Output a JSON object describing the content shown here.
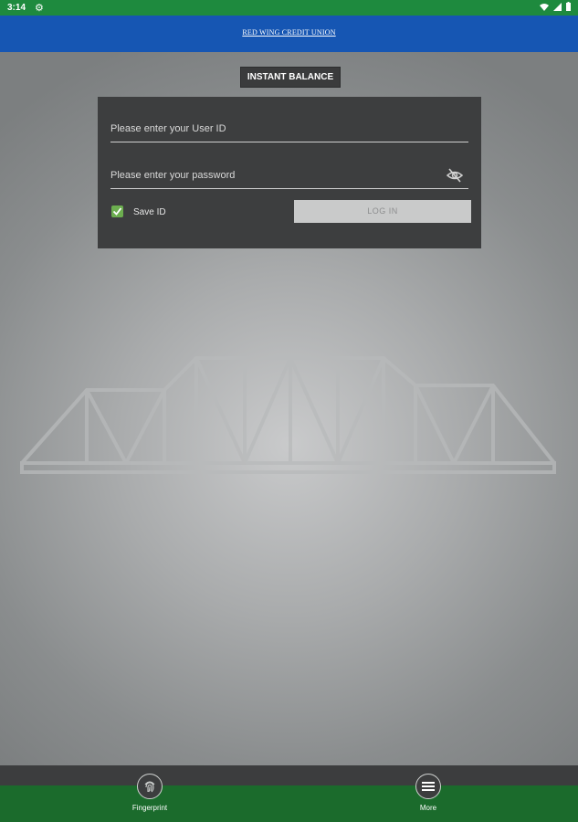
{
  "status_bar": {
    "time": "3:14",
    "settings_icon": "gear-icon",
    "right_icons": [
      "wifi-icon",
      "signal-icon",
      "battery-icon"
    ]
  },
  "header": {
    "brand_text": "RED WING CREDIT UNION",
    "color": "#1656b3"
  },
  "instant_balance": {
    "label": "INSTANT BALANCE"
  },
  "login": {
    "user_placeholder": "Please enter your User ID",
    "user_value": "",
    "password_placeholder": "Please enter your password",
    "password_value": "",
    "visibility_icon": "eye-off-icon",
    "save_id_label": "Save ID",
    "save_id_checked": true,
    "login_button_label": "LOG IN"
  },
  "bottom_nav": {
    "items": [
      {
        "label": "Fingerprint",
        "icon": "fingerprint-icon"
      },
      {
        "label": "More",
        "icon": "menu-icon"
      }
    ],
    "color": "#1b6b2c"
  },
  "colors": {
    "status_bar": "#1e8a3e",
    "card": "#3d3e3f",
    "checkbox": "#6cae4f"
  }
}
